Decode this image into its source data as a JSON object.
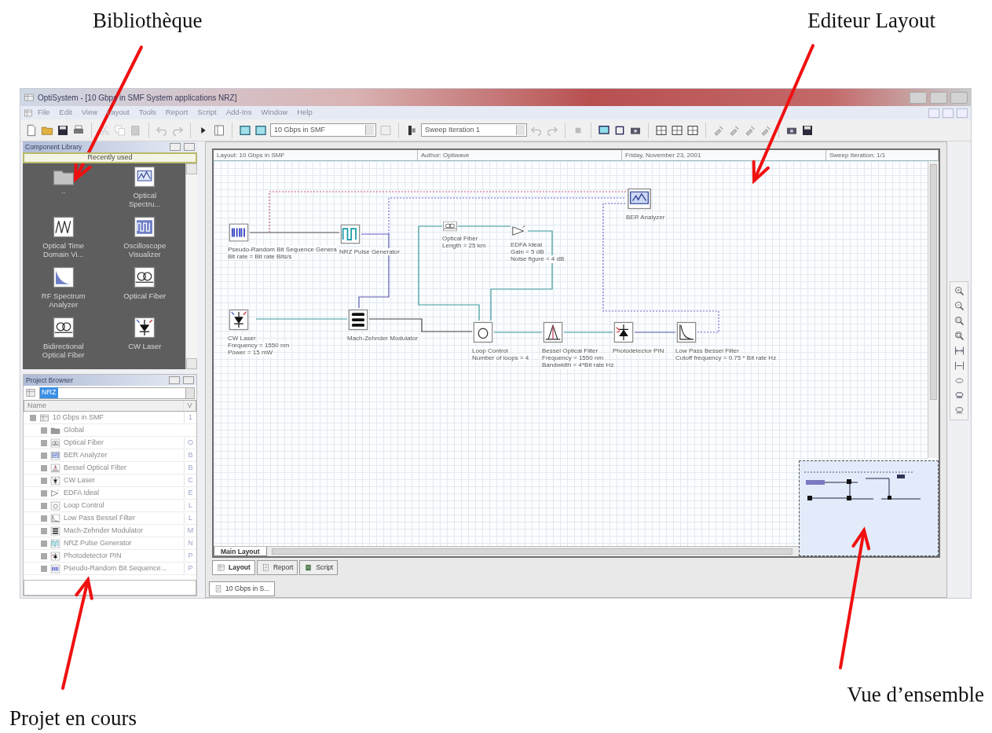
{
  "annotations": {
    "top": [
      {
        "text": "Bibliothèque"
      },
      {
        "text": "Editeur Layout"
      }
    ],
    "bottom": [
      {
        "text": "Projet en cours"
      },
      {
        "text": "Vue d’ensemble"
      }
    ]
  },
  "window": {
    "title": "OptiSystem - [10 Gbps in SMF System applications NRZ]"
  },
  "menu": [
    "File",
    "Edit",
    "View",
    "Layout",
    "Tools",
    "Report",
    "Script",
    "Add-Ins",
    "Window",
    "Help"
  ],
  "toolbar": {
    "layout_select": "10 Gbps in SMF",
    "sweep_select": "Sweep Iteration 1"
  },
  "component_library": {
    "title": "Component Library",
    "category": "Recently used",
    "items": [
      {
        "kind": "folder",
        "label": ".."
      },
      {
        "kind": "spectrum",
        "label": "Optical Spectru..."
      },
      {
        "kind": "timescope",
        "label": "Optical Time Domain Vi..."
      },
      {
        "kind": "scope",
        "label": "Oscilloscope Visualizer"
      },
      {
        "kind": "rfspectrum",
        "label": "RF Spectrum Analyzer"
      },
      {
        "kind": "fiber",
        "label": "Optical Fiber"
      },
      {
        "kind": "fiber",
        "label": "Bidirectional Optical Fiber"
      },
      {
        "kind": "laser",
        "label": "CW Laser"
      }
    ]
  },
  "project_browser": {
    "title": "Project Browser",
    "filter": "NRZ",
    "columns": [
      "Name",
      "V"
    ],
    "tree": [
      {
        "kind": "layout",
        "label": "10 Gbps in SMF",
        "letter": "1",
        "children": [
          {
            "kind": "global",
            "label": "Global"
          },
          {
            "kind": "fiber",
            "label": "Optical Fiber",
            "letter": "O"
          },
          {
            "kind": "analyzer",
            "label": "BER Analyzer",
            "letter": "B"
          },
          {
            "kind": "bandpass",
            "label": "Bessel Optical Filter",
            "letter": "B"
          },
          {
            "kind": "laser",
            "label": "CW Laser",
            "letter": "C"
          },
          {
            "kind": "edfa",
            "label": "EDFA Ideal",
            "letter": "E"
          },
          {
            "kind": "loop",
            "label": "Loop Control",
            "letter": "L"
          },
          {
            "kind": "lowpass",
            "label": "Low Pass Bessel Filter",
            "letter": "L"
          },
          {
            "kind": "modulator",
            "label": "Mach-Zehnder Modulator",
            "letter": "M"
          },
          {
            "kind": "nrz",
            "label": "NRZ Pulse Generator",
            "letter": "N"
          },
          {
            "kind": "photodetector",
            "label": "Photodetector PIN",
            "letter": "P"
          },
          {
            "kind": "prbs",
            "label": "Pseudo-Random Bit Sequence...",
            "letter": "P"
          }
        ]
      }
    ]
  },
  "layout_editor": {
    "header": [
      "Layout: 10 Gbps in SMF",
      "Author: Optiwave",
      "Friday, November 23, 2001",
      "Sweep Iteration: 1/1"
    ],
    "components": [
      {
        "kind": "prbs",
        "lines": [
          "Pseudo-Random Bit Sequence Genera",
          "Bit rate = Bit rate  Bits/s"
        ]
      },
      {
        "kind": "nrz",
        "lines": [
          "NRZ Pulse Generator"
        ]
      },
      {
        "kind": "fiber",
        "lines": [
          "Optical Fiber",
          "Length = 25 km"
        ]
      },
      {
        "kind": "edfa",
        "lines": [
          "EDFA Ideal",
          "Gain = 5 dB",
          "Noise figure = 4 dB"
        ]
      },
      {
        "kind": "analyzer",
        "lines": [
          "BER Analyzer"
        ]
      },
      {
        "kind": "laser",
        "lines": [
          "CW Laser",
          "Frequency = 1550 nm",
          "Power = 15 mW"
        ]
      },
      {
        "kind": "modulator",
        "lines": [
          "Mach-Zehnder Modulator"
        ]
      },
      {
        "kind": "loop",
        "lines": [
          "Loop Control",
          "Number of loops = 4"
        ]
      },
      {
        "kind": "bandpass",
        "lines": [
          "Bessel Optical Filter",
          "Frequency = 1550 nm",
          "Bandwidth = 4*Bit rate Hz"
        ]
      },
      {
        "kind": "photodetector",
        "lines": [
          "Photodetector PIN"
        ]
      },
      {
        "kind": "lowpass",
        "lines": [
          "Low Pass Bessel Filter",
          "Cutoff frequency = 0.75 * Bit rate Hz"
        ]
      }
    ],
    "sheet_tabs": [
      {
        "label": "Main Layout",
        "selected": true
      }
    ],
    "view_tabs": [
      {
        "kind": "layout",
        "label": "Layout",
        "selected": true
      },
      {
        "kind": "report",
        "label": "Report",
        "selected": false
      },
      {
        "kind": "script",
        "label": "Script",
        "selected": false
      }
    ],
    "document_tabs": [
      {
        "label": "10 Gbps in S...",
        "selected": true
      }
    ]
  }
}
